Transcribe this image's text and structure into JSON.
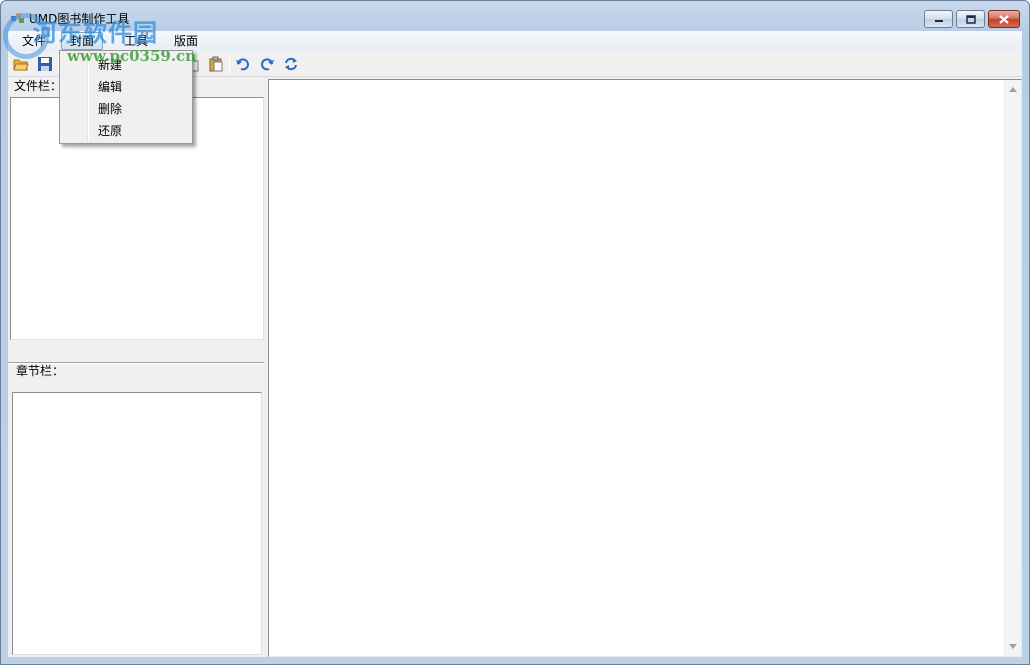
{
  "window": {
    "title": "UMD图书制作工具"
  },
  "menubar": {
    "items": [
      "文件",
      "封面",
      "工具",
      "版面"
    ]
  },
  "cover_menu": {
    "items": [
      "新建",
      "编辑",
      "删除",
      "还原"
    ]
  },
  "toolbar": {
    "icons": [
      "open-icon",
      "save-icon",
      "cut-icon",
      "copy-icon",
      "paste-icon",
      "undo-icon",
      "redo-icon",
      "refresh-icon"
    ]
  },
  "file_panel": {
    "label": "文件栏："
  },
  "chapter_panel": {
    "label": "章节栏："
  },
  "watermark": {
    "brand": "河东软件园",
    "url": "www.pc0359.cn"
  }
}
